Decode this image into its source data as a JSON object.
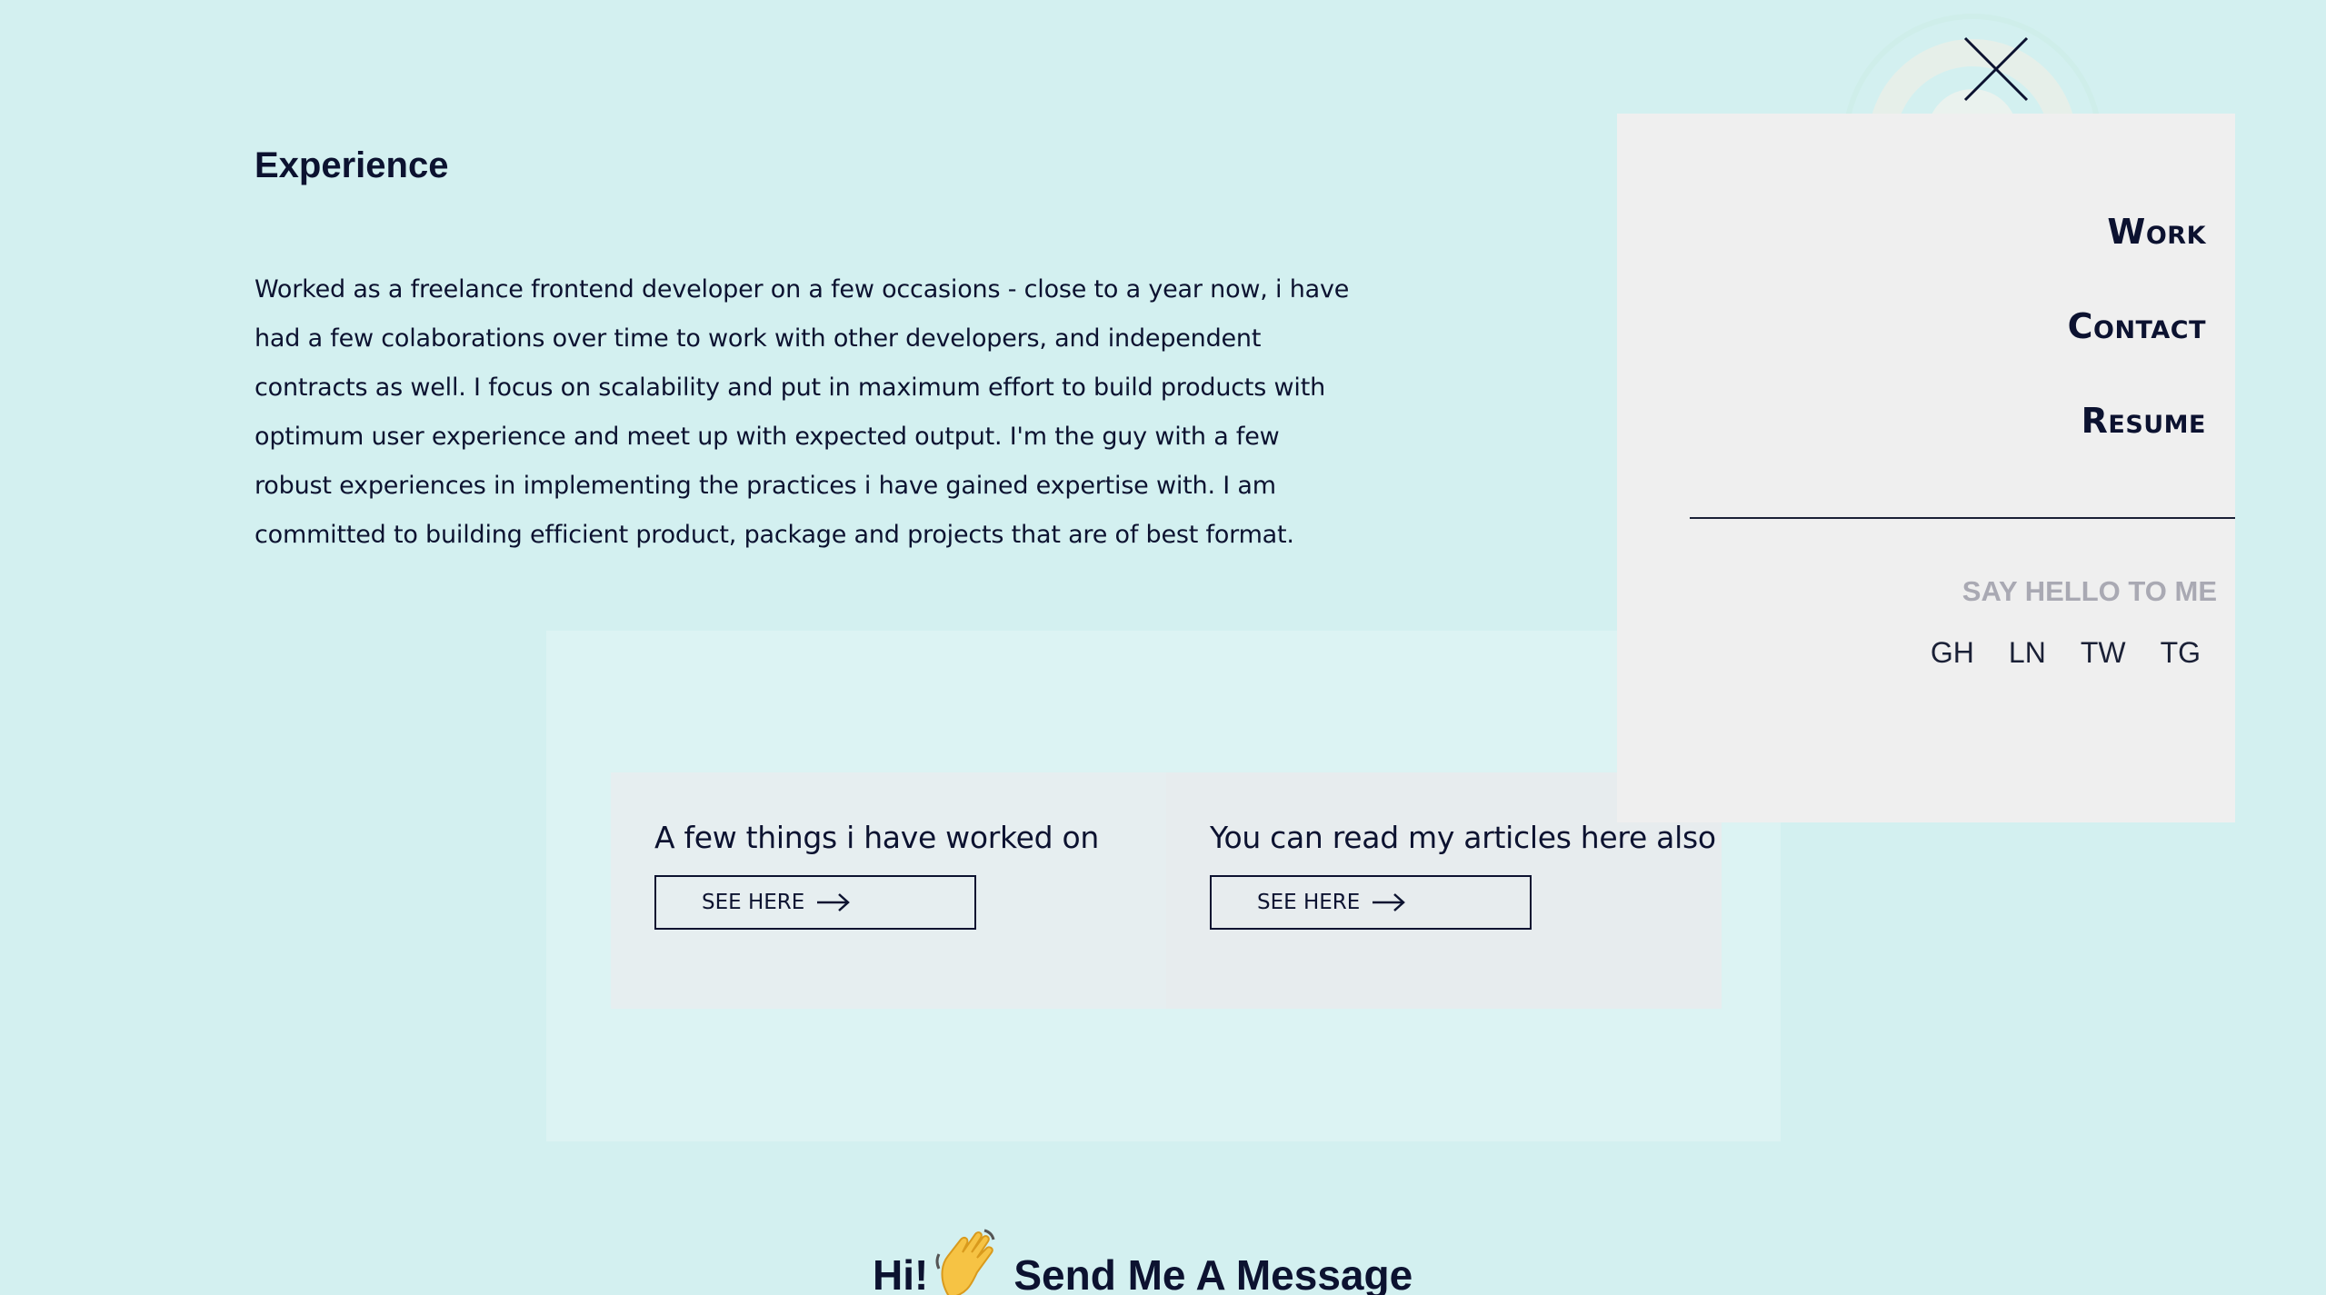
{
  "experience": {
    "heading": "Experience",
    "body": "Worked as a freelance frontend developer on a few occasions - close to a year now, i have had a few colaborations over time to work with other developers, and independent contracts as well. I focus on scalability and put in maximum effort to build products with optimum user experience and meet up with expected output. I'm the guy with a few robust experiences in implementing the practices i have gained expertise with. I am committed to building efficient product, package and projects that are of best format."
  },
  "cards": [
    {
      "title": "A few things i have worked on",
      "button_label": "SEE HERE",
      "icon": "arrow-right-icon"
    },
    {
      "title": "You can read my articles here also",
      "button_label": "SEE HERE",
      "icon": "arrow-right-icon"
    }
  ],
  "contact_section": {
    "heading_start": "Hi!",
    "emoji_icon": "waving-hand-icon",
    "heading_end": "Send Me A Message"
  },
  "menu": {
    "close_icon": "close-icon",
    "items": [
      {
        "label": "Work"
      },
      {
        "label": "Contact"
      },
      {
        "label": "Resume"
      }
    ],
    "say_hello": "SAY HELLO TO ME",
    "socials": [
      "GH",
      "LN",
      "TW",
      "TG"
    ]
  },
  "colors": {
    "background": "#d3f0f0",
    "panel": "#dcf3f3",
    "drawer": "#efefef",
    "text": "#0c1230",
    "muted": "#a9a9b3"
  }
}
